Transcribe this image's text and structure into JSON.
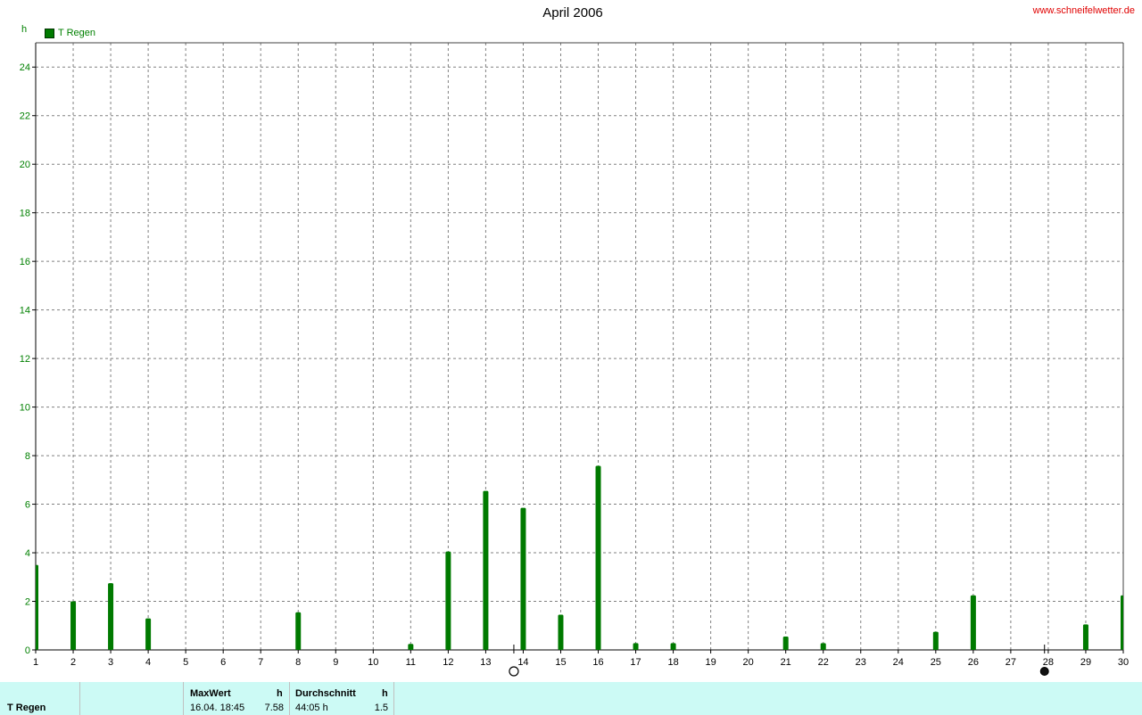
{
  "header": {
    "title": "April 2006",
    "site": "www.schneifelwetter.de"
  },
  "chart_data": {
    "type": "bar",
    "unit": "h",
    "ylim": [
      0,
      25
    ],
    "yticks": [
      0,
      2,
      4,
      6,
      8,
      10,
      12,
      14,
      16,
      18,
      20,
      22,
      24
    ],
    "xlim": [
      1,
      30
    ],
    "xticks": [
      "1",
      "2",
      "3",
      "4",
      "5",
      "6",
      "7",
      "8",
      "9",
      "10",
      "11",
      "12",
      "13",
      "14",
      "15",
      "16",
      "17",
      "18",
      "19",
      "20",
      "21",
      "22",
      "23",
      "24",
      "25",
      "26",
      "27",
      "28",
      "29",
      "30"
    ],
    "grid": true,
    "legend_position": "top-left",
    "series": [
      {
        "name": "T Regen",
        "color": "#007a00",
        "days": [
          1,
          2,
          3,
          4,
          5,
          6,
          7,
          8,
          9,
          10,
          11,
          12,
          13,
          14,
          15,
          16,
          17,
          18,
          19,
          20,
          21,
          22,
          23,
          24,
          25,
          26,
          27,
          28,
          29,
          30
        ],
        "values": [
          3.5,
          2.0,
          2.75,
          1.3,
          0,
          0,
          0,
          1.55,
          0,
          0,
          0.25,
          4.05,
          6.55,
          5.85,
          1.45,
          7.58,
          0.28,
          0.28,
          0,
          0,
          0.55,
          0.28,
          0,
          0,
          0.75,
          2.25,
          0,
          0,
          1.05,
          2.25
        ]
      }
    ],
    "moon_phases": [
      {
        "day": 13.75,
        "phase": "full-moon"
      },
      {
        "day": 27.9,
        "phase": "new-moon"
      }
    ]
  },
  "footer": {
    "series_label": "T Regen",
    "max_header": "MaxWert",
    "max_unit": "h",
    "max_datetime": "16.04.  18:45",
    "max_value": "7.58",
    "avg_header": "Durchschnitt",
    "avg_unit": "h",
    "avg_total": "44:05 h",
    "avg_value": "1.5"
  }
}
